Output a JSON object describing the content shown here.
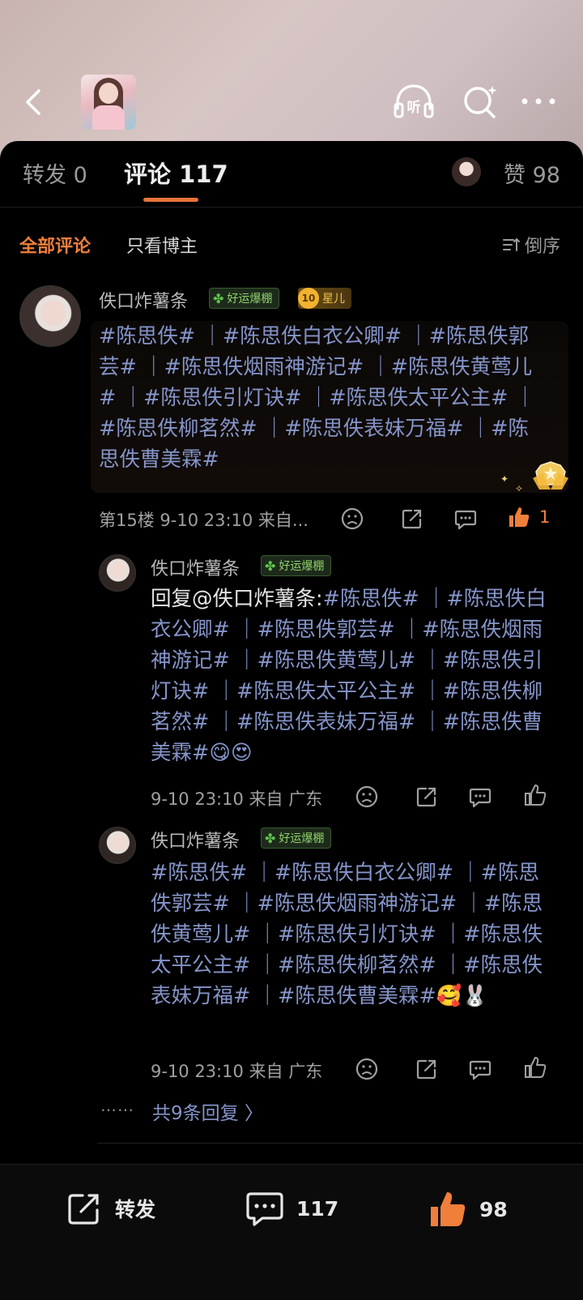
{
  "header": {
    "back_icon": "chevron-left-icon",
    "listen_label": "听",
    "search_icon": "search-icon",
    "more_icon": "more-horizontal-icon"
  },
  "tabs": {
    "repost_label": "转发 0",
    "comments_label": "评论 117",
    "likes_label": "赞 98"
  },
  "filter": {
    "all_label": "全部评论",
    "author_only_label": "只看博主",
    "sort_label": "倒序"
  },
  "comment": {
    "username": "佚口炸薯条",
    "luck_badge": "好运爆棚",
    "star_level": "10",
    "star_badge": "星儿",
    "text": "#陈思佚# ｜#陈思佚白衣公卿# ｜#陈思佚郭芸# ｜#陈思佚烟雨神游记#  ｜#陈思佚黄莺儿# ｜#陈思佚引灯诀# ｜#陈思佚太平公主# ｜#陈思佚柳茗然# ｜#陈思佚表妹万福# ｜#陈思佚曹美霖#",
    "meta": "第15楼 9-10 23:10 来自...",
    "likes": "1"
  },
  "replies": [
    {
      "username": "佚口炸薯条",
      "luck_badge": "好运爆棚",
      "prefix": "回复@佚口炸薯条:",
      "text": "#陈思佚# ｜#陈思佚白衣公卿# ｜#陈思佚郭芸# ｜#陈思佚烟雨神游记#  ｜#陈思佚黄莺儿# ｜#陈思佚引灯诀# ｜#陈思佚太平公主# ｜#陈思佚柳茗然# ｜#陈思佚表妹万福# ｜#陈思佚曹美霖#",
      "emoji": "😋😍",
      "meta": "9-10 23:10 来自 广东"
    },
    {
      "username": "佚口炸薯条",
      "luck_badge": "好运爆棚",
      "text": "#陈思佚# ｜#陈思佚白衣公卿# ｜#陈思佚郭芸# ｜#陈思佚烟雨神游记#  ｜#陈思佚黄莺儿# ｜#陈思佚引灯诀# ｜#陈思佚太平公主# ｜#陈思佚柳茗然# ｜#陈思佚表妹万福# ｜#陈思佚曹美霖#",
      "emoji": "🥰🐰",
      "meta": "9-10 23:10 来自 广东"
    }
  ],
  "more_replies": {
    "dots": "……",
    "label": "共9条回复 〉"
  },
  "bottom_bar": {
    "repost_label": "转发",
    "comment_count": "117",
    "like_count": "98"
  },
  "colors": {
    "accent": "#f07f3b",
    "link": "#8594c9",
    "background": "#000000"
  }
}
